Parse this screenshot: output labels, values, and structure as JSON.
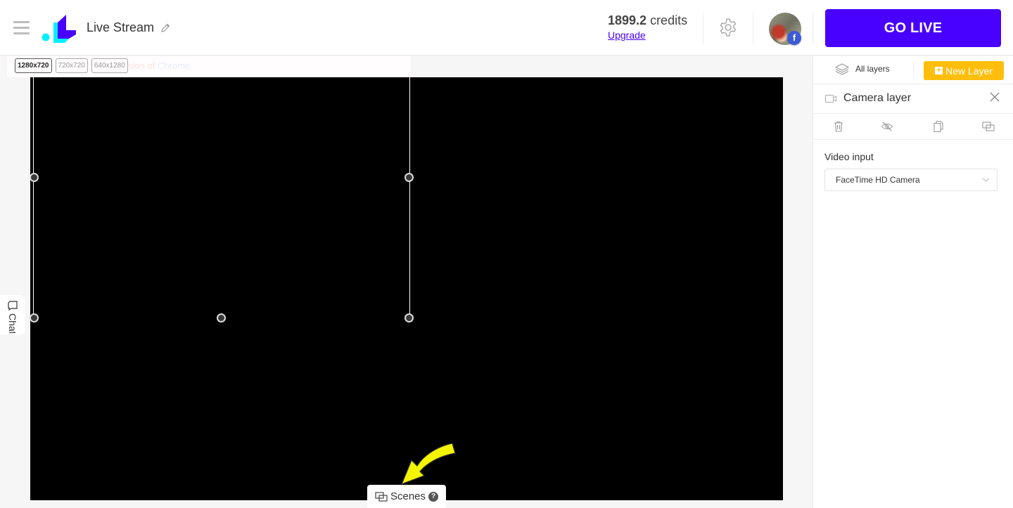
{
  "header": {
    "menu_icon": "hamburger-icon",
    "logo": "app-logo",
    "title": "Live Stream",
    "edit_icon": "pencil-icon",
    "credits_amount": "1899.2",
    "credits_label": " credits",
    "upgrade_label": "Upgrade",
    "settings_icon": "gear-icon",
    "avatar_badge": "f",
    "go_live_label": "GO LIVE",
    "colors": {
      "go_live": "#4800ff",
      "upgrade_link": "#4b00ff",
      "logo_cyan": "#00f0ff",
      "logo_purple": "#4800ff"
    }
  },
  "stage": {
    "banner_text": "sion of ",
    "banner_link": "Chrome.",
    "resolutions": [
      {
        "label": "1280x720",
        "active": true
      },
      {
        "label": "720x720",
        "active": false
      },
      {
        "label": "640x1280",
        "active": false
      }
    ],
    "chat_label": "Chat",
    "scenes_label": "Scenes",
    "scenes_help": "?",
    "arrow_color": "#f5f500"
  },
  "panel": {
    "all_layers_label": "All layers",
    "new_layer_label": "New Layer",
    "new_layer_color": "#ffbe0b",
    "layer_title": "Camera layer",
    "tools": [
      "trash-icon",
      "eye-off-icon",
      "copy-icon",
      "scenes-icon"
    ],
    "video_input_label": "Video input",
    "video_input_value": "FaceTime HD Camera"
  }
}
